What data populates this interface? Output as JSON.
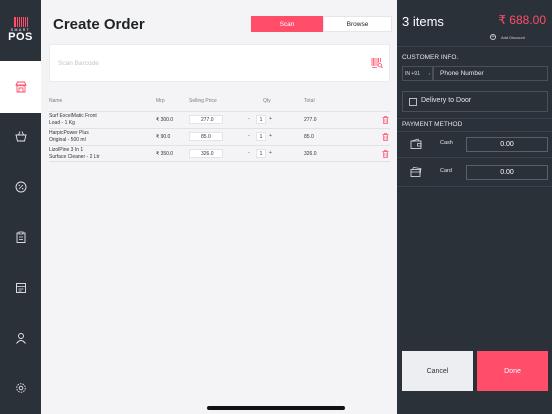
{
  "brand": {
    "logo_top": "SMART",
    "logo_main": "POS"
  },
  "sidebar": {
    "items": [
      {
        "name": "store",
        "icon": "store-icon",
        "active": true
      },
      {
        "name": "basket",
        "icon": "basket-icon",
        "active": false
      },
      {
        "name": "discount",
        "icon": "percent-badge-icon",
        "active": false
      },
      {
        "name": "orders",
        "icon": "clipboard-icon",
        "active": false
      },
      {
        "name": "reports",
        "icon": "receipt-icon",
        "active": false
      },
      {
        "name": "customers",
        "icon": "user-icon",
        "active": false
      },
      {
        "name": "settings",
        "icon": "gear-icon",
        "active": false
      }
    ]
  },
  "main": {
    "title": "Create Order",
    "tabs": [
      {
        "label": "Scan",
        "active": true
      },
      {
        "label": "Browse",
        "active": false
      }
    ],
    "scan_placeholder": "Scan Barcode",
    "table": {
      "headers": [
        "Name",
        "Mrp",
        "Selling Price",
        "Qty",
        "Total"
      ],
      "rows": [
        {
          "name_line1": "Surf ExcelMatic Front",
          "name_line2": "Load - 1 Kg",
          "mrp": "₹ 300.0",
          "selling_price": "277.0",
          "qty": "1",
          "total": "277.0"
        },
        {
          "name_line1": "HarpicPower Plus",
          "name_line2": "Original - 500 ml",
          "mrp": "₹ 90.0",
          "selling_price": "85.0",
          "qty": "1",
          "total": "85.0"
        },
        {
          "name_line1": "LizolPine 3 In 1",
          "name_line2": "Surface Cleaner - 2 Ltr",
          "mrp": "₹ 350.0",
          "selling_price": "326.0",
          "qty": "1",
          "total": "326.0"
        }
      ]
    }
  },
  "panel": {
    "items_count": "3 items",
    "total_amount": "₹ 688.00",
    "add_discount": "Add Discount",
    "customer_heading": "CUSTOMER INFO.",
    "country_code": "IN +91",
    "phone_placeholder": "Phone Number",
    "delivery_label": "Delivery to Door",
    "delivery_checked": false,
    "payment_heading": "PAYMENT METHOD",
    "payments": [
      {
        "label": "Cash",
        "value": "0.00",
        "icon": "wallet-icon"
      },
      {
        "label": "Card",
        "value": "0.00",
        "icon": "card-icon"
      }
    ],
    "cancel_label": "Cancel",
    "done_label": "Done"
  },
  "colors": {
    "accent": "#ff4d6a",
    "sidebar_bg": "#2b3139",
    "panel_bg": "#2b3139",
    "main_bg": "#f4f4f6"
  }
}
